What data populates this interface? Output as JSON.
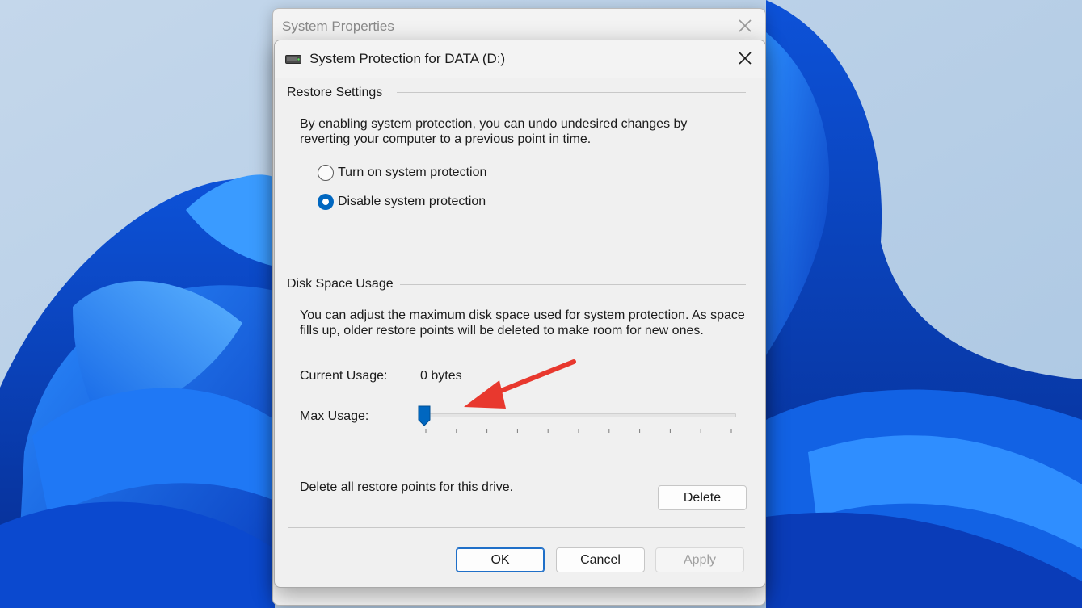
{
  "back_window": {
    "title": "System Properties"
  },
  "dialog": {
    "title": "System Protection for DATA (D:)",
    "restore_settings": {
      "group_title": "Restore Settings",
      "description_line1": "By enabling system protection, you can undo undesired changes by",
      "description_line2": "reverting your computer to a previous point in time.",
      "options": [
        {
          "label": "Turn on system protection",
          "selected": false
        },
        {
          "label": "Disable system protection",
          "selected": true
        }
      ]
    },
    "disk_space": {
      "group_title": "Disk Space Usage",
      "description_line1": "You can adjust the maximum disk space used for system protection. As space",
      "description_line2": "fills up, older restore points will be deleted to make room for new ones.",
      "current_usage_label": "Current Usage:",
      "current_usage_value": "0 bytes",
      "max_usage_label": "Max Usage:",
      "max_usage_fraction": 0
    },
    "delete_row": {
      "text": "Delete all restore points for this drive.",
      "button": "Delete"
    },
    "buttons": {
      "ok": "OK",
      "cancel": "Cancel",
      "apply": "Apply"
    }
  },
  "colors": {
    "accent": "#0067c0",
    "annotation_arrow": "#e8382e",
    "dialog_bg": "#f0f0f0"
  },
  "icons": [
    "drive-icon",
    "close-icon",
    "slider-thumb-icon",
    "arrow-annotation"
  ]
}
